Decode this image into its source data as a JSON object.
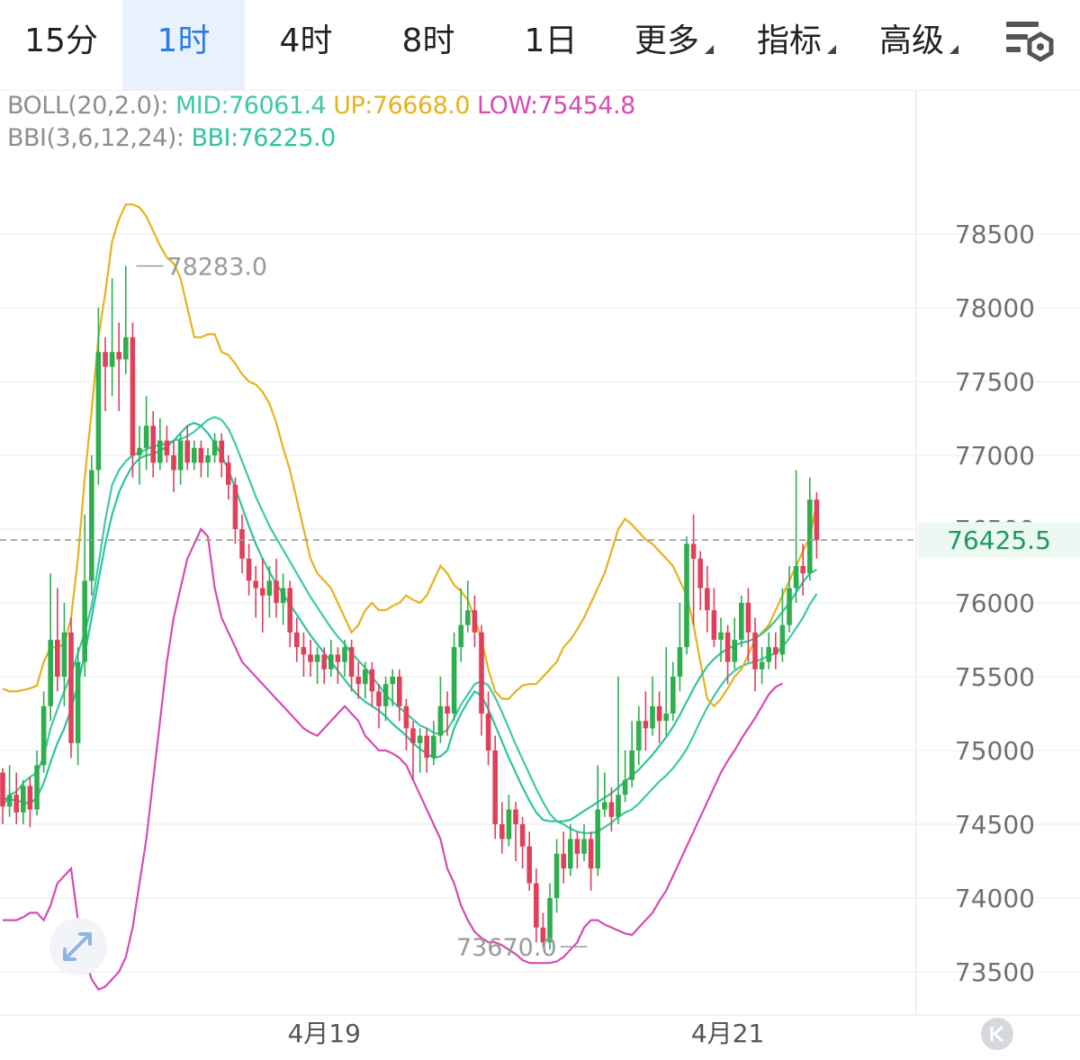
{
  "toolbar": {
    "tabs": [
      {
        "label": "15分",
        "active": false,
        "dropdown": false
      },
      {
        "label": "1时",
        "active": true,
        "dropdown": false
      },
      {
        "label": "4时",
        "active": false,
        "dropdown": false
      },
      {
        "label": "8时",
        "active": false,
        "dropdown": false
      },
      {
        "label": "1日",
        "active": false,
        "dropdown": false
      },
      {
        "label": "更多",
        "active": false,
        "dropdown": true
      },
      {
        "label": "指标",
        "active": false,
        "dropdown": true
      },
      {
        "label": "高级",
        "active": false,
        "dropdown": true
      }
    ],
    "settings_icon": "chart-settings-icon"
  },
  "legend": {
    "boll_name": "BOLL(20,2.0):",
    "boll_mid": "MID:76061.4",
    "boll_up": "UP:76668.0",
    "boll_low": "LOW:75454.8",
    "bbi_name": "BBI(3,6,12,24):",
    "bbi_value": "BBI:76225.0"
  },
  "colors": {
    "up": "#2fae4f",
    "down": "#e0405a",
    "boll_mid": "#3ec9a8",
    "boll_up": "#e6b21e",
    "boll_low": "#d64bb4",
    "bbi": "#2ec4a0",
    "active_tab": "#2d7be5",
    "grid": "#eef0f3"
  },
  "icons": {
    "expand": "expand-arrows-icon",
    "scroll_left": "scroll-to-start-icon"
  },
  "chart_data": {
    "type": "candlestick",
    "interval": "1时",
    "ylim": [
      73350,
      78900
    ],
    "y_ticks": [
      73500,
      74000,
      74500,
      75000,
      75500,
      76000,
      76500,
      77000,
      77500,
      78000,
      78500
    ],
    "y_tick_labels": [
      "73500",
      "74000",
      "74500",
      "75000",
      "75500",
      "76000",
      "76500",
      "77000",
      "77500",
      "78000",
      "78500"
    ],
    "x_labels": [
      {
        "label": "4月19",
        "index": 47
      },
      {
        "label": "4月21",
        "index": 106
      }
    ],
    "current_price": 76425.5,
    "current_price_label": "76425.5",
    "high_label": {
      "value": 78283.0,
      "text": "78283.0",
      "index": 19
    },
    "low_label": {
      "value": 73670.0,
      "text": "73670.0",
      "index": 86
    },
    "candles": [
      [
        74850,
        74620,
        74880,
        74500
      ],
      [
        74620,
        74700,
        74900,
        74550
      ],
      [
        74700,
        74580,
        74850,
        74500
      ],
      [
        74580,
        74760,
        74800,
        74500
      ],
      [
        74760,
        74600,
        74820,
        74480
      ],
      [
        74600,
        74900,
        75000,
        74560
      ],
      [
        74900,
        75300,
        75400,
        74850
      ],
      [
        75300,
        75750,
        76200,
        75200
      ],
      [
        75750,
        75500,
        76100,
        75400
      ],
      [
        75500,
        75800,
        76000,
        75300
      ],
      [
        75800,
        75050,
        75900,
        74950
      ],
      [
        75050,
        75600,
        75700,
        74900
      ],
      [
        75600,
        76150,
        76600,
        75500
      ],
      [
        76150,
        76900,
        77000,
        76050
      ],
      [
        76900,
        77700,
        78000,
        76800
      ],
      [
        77700,
        77600,
        77800,
        77300
      ],
      [
        77600,
        77700,
        78200,
        77400
      ],
      [
        77700,
        77650,
        77900,
        77300
      ],
      [
        77650,
        77800,
        78283,
        77550
      ],
      [
        77800,
        77000,
        77900,
        76850
      ],
      [
        77000,
        77050,
        77200,
        76800
      ],
      [
        77050,
        77200,
        77400,
        76900
      ],
      [
        77200,
        76950,
        77300,
        76850
      ],
      [
        76950,
        77100,
        77250,
        76900
      ],
      [
        77100,
        77000,
        77200,
        76950
      ],
      [
        77000,
        76900,
        77100,
        76750
      ],
      [
        76900,
        77100,
        77150,
        76800
      ],
      [
        77100,
        76950,
        77200,
        76900
      ],
      [
        76950,
        77050,
        77100,
        76900
      ],
      [
        77050,
        76950,
        77100,
        76850
      ],
      [
        76950,
        77000,
        77050,
        76850
      ],
      [
        77000,
        77100,
        77150,
        76950
      ],
      [
        77100,
        76950,
        77150,
        76850
      ],
      [
        76950,
        76800,
        77000,
        76700
      ],
      [
        76800,
        76500,
        76850,
        76400
      ],
      [
        76500,
        76300,
        76600,
        76200
      ],
      [
        76300,
        76150,
        76400,
        76050
      ],
      [
        76150,
        76100,
        76250,
        75900
      ],
      [
        76100,
        76050,
        76300,
        75800
      ],
      [
        76050,
        76150,
        76250,
        75900
      ],
      [
        76150,
        76000,
        76300,
        75900
      ],
      [
        76000,
        76100,
        76200,
        75850
      ],
      [
        76100,
        75800,
        76150,
        75700
      ],
      [
        75800,
        75700,
        75900,
        75600
      ],
      [
        75700,
        75650,
        75800,
        75500
      ],
      [
        75650,
        75600,
        75750,
        75500
      ],
      [
        75600,
        75650,
        75700,
        75450
      ],
      [
        75650,
        75550,
        75700,
        75450
      ],
      [
        75550,
        75650,
        75750,
        75500
      ],
      [
        75650,
        75600,
        75700,
        75450
      ],
      [
        75600,
        75700,
        75750,
        75500
      ],
      [
        75700,
        75500,
        75750,
        75400
      ],
      [
        75500,
        75450,
        75600,
        75350
      ],
      [
        75450,
        75550,
        75600,
        75350
      ],
      [
        75550,
        75400,
        75600,
        75300
      ],
      [
        75400,
        75300,
        75450,
        75150
      ],
      [
        75300,
        75450,
        75500,
        75200
      ],
      [
        75450,
        75500,
        75550,
        75300
      ],
      [
        75500,
        75300,
        75550,
        75200
      ],
      [
        75300,
        75150,
        75350,
        75000
      ],
      [
        75150,
        75050,
        75200,
        74800
      ],
      [
        75050,
        75100,
        75150,
        74850
      ],
      [
        75100,
        74950,
        75150,
        74850
      ],
      [
        74950,
        75100,
        75200,
        74900
      ],
      [
        75100,
        75300,
        75500,
        75050
      ],
      [
        75300,
        75250,
        75400,
        75100
      ],
      [
        75250,
        75700,
        75800,
        75200
      ],
      [
        75700,
        75850,
        76100,
        75600
      ],
      [
        75850,
        75950,
        76150,
        75800
      ],
      [
        75950,
        75800,
        76050,
        75700
      ],
      [
        75800,
        75250,
        75850,
        75100
      ],
      [
        75250,
        75000,
        75400,
        74900
      ],
      [
        75000,
        74500,
        75100,
        74400
      ],
      [
        74500,
        74400,
        74650,
        74300
      ],
      [
        74400,
        74600,
        74700,
        74350
      ],
      [
        74600,
        74500,
        74650,
        74250
      ],
      [
        74500,
        74350,
        74550,
        74200
      ],
      [
        74350,
        74100,
        74450,
        74050
      ],
      [
        74100,
        73800,
        74200,
        73700
      ],
      [
        73800,
        73700,
        73900,
        73670
      ],
      [
        73700,
        74000,
        74100,
        73650
      ],
      [
        74000,
        74300,
        74400,
        73900
      ],
      [
        74300,
        74200,
        74450,
        74100
      ],
      [
        74200,
        74400,
        74500,
        74150
      ],
      [
        74400,
        74300,
        74450,
        74200
      ],
      [
        74300,
        74400,
        74500,
        74250
      ],
      [
        74400,
        74200,
        74450,
        74050
      ],
      [
        74200,
        74600,
        74900,
        74150
      ],
      [
        74600,
        74650,
        74850,
        74550
      ],
      [
        74650,
        74550,
        74750,
        74450
      ],
      [
        74550,
        74700,
        75500,
        74500
      ],
      [
        74700,
        74800,
        75000,
        74650
      ],
      [
        74800,
        75000,
        75200,
        74750
      ],
      [
        75000,
        75200,
        75300,
        74900
      ],
      [
        75200,
        75150,
        75400,
        75000
      ],
      [
        75150,
        75300,
        75500,
        75100
      ],
      [
        75300,
        75200,
        75400,
        75050
      ],
      [
        75200,
        75250,
        75700,
        75100
      ],
      [
        75250,
        75500,
        75600,
        75200
      ],
      [
        75500,
        75700,
        76000,
        75400
      ],
      [
        75700,
        76400,
        76450,
        75650
      ],
      [
        76400,
        76300,
        76600,
        75850
      ],
      [
        76300,
        76100,
        76350,
        75950
      ],
      [
        76100,
        75950,
        76250,
        75800
      ],
      [
        75950,
        75750,
        76100,
        75700
      ],
      [
        75750,
        75800,
        75900,
        75600
      ],
      [
        75800,
        75600,
        75850,
        75450
      ],
      [
        75600,
        75750,
        75900,
        75550
      ],
      [
        75750,
        76000,
        76050,
        75700
      ],
      [
        76000,
        75800,
        76100,
        75600
      ],
      [
        75800,
        75550,
        75900,
        75400
      ],
      [
        75550,
        75600,
        75700,
        75450
      ],
      [
        75600,
        75700,
        75800,
        75550
      ],
      [
        75700,
        75650,
        75800,
        75550
      ],
      [
        75650,
        75850,
        76100,
        75600
      ],
      [
        75850,
        76100,
        76250,
        75800
      ],
      [
        76100,
        76250,
        76900,
        76000
      ],
      [
        76250,
        76200,
        76400,
        76050
      ],
      [
        76200,
        76700,
        76850,
        76150
      ],
      [
        76700,
        76425,
        76750,
        76300
      ]
    ],
    "series": [
      {
        "name": "MID",
        "color": "#3ec9a8",
        "values": [
          74620,
          74700,
          74720,
          74780,
          74820,
          74850,
          74960,
          75150,
          75280,
          75400,
          75520,
          75660,
          75800,
          75980,
          76260,
          76560,
          76800,
          76900,
          76960,
          77000,
          77020,
          77040,
          77060,
          77070,
          77080,
          77100,
          77110,
          77130,
          77160,
          77200,
          77240,
          77260,
          77240,
          77180,
          77080,
          76960,
          76840,
          76720,
          76620,
          76520,
          76440,
          76360,
          76280,
          76200,
          76120,
          76040,
          75970,
          75900,
          75830,
          75770,
          75720,
          75660,
          75610,
          75560,
          75500,
          75440,
          75380,
          75330,
          75290,
          75250,
          75210,
          75170,
          75150,
          75120,
          75110,
          75140,
          75220,
          75310,
          75380,
          75450,
          75470,
          75440,
          75360,
          75260,
          75150,
          75040,
          74940,
          74840,
          74740,
          74650,
          74570,
          74520,
          74500,
          74470,
          74450,
          74440,
          74440,
          74450,
          74480,
          74510,
          74550,
          74580,
          74600,
          74640,
          74690,
          74740,
          74790,
          74830,
          74880,
          74940,
          75010,
          75100,
          75200,
          75290,
          75370,
          75440,
          75500,
          75540,
          75570,
          75590,
          75600,
          75620,
          75640,
          75660,
          75700,
          75760,
          75830,
          75900,
          75990,
          76061
        ]
      },
      {
        "name": "UP",
        "color": "#e6b21e",
        "values": [
          75420,
          75400,
          75400,
          75410,
          75420,
          75440,
          75600,
          75700,
          75700,
          75720,
          75900,
          76300,
          76850,
          77300,
          77800,
          78100,
          78450,
          78600,
          78700,
          78700,
          78680,
          78620,
          78520,
          78420,
          78340,
          78300,
          78200,
          78000,
          77800,
          77800,
          77820,
          77820,
          77700,
          77680,
          77620,
          77550,
          77500,
          77480,
          77430,
          77350,
          77220,
          77050,
          76900,
          76700,
          76500,
          76300,
          76200,
          76150,
          76100,
          76000,
          75900,
          75800,
          75850,
          75950,
          76000,
          75950,
          75950,
          75980,
          76000,
          76050,
          76020,
          76000,
          76050,
          76150,
          76250,
          76200,
          76120,
          76080,
          76020,
          75900,
          75750,
          75550,
          75400,
          75350,
          75350,
          75400,
          75440,
          75450,
          75450,
          75500,
          75550,
          75600,
          75700,
          75750,
          75820,
          75900,
          76000,
          76100,
          76200,
          76350,
          76500,
          76570,
          76530,
          76480,
          76430,
          76400,
          76350,
          76300,
          76250,
          76150,
          76050,
          75850,
          75600,
          75350,
          75300,
          75350,
          75420,
          75500,
          75550,
          75650,
          75750,
          75800,
          75850,
          75950,
          76050,
          76150,
          76250,
          76350,
          76450,
          76668
        ]
      },
      {
        "name": "LOW",
        "color": "#d64bb4",
        "values": [
          73850,
          73850,
          73850,
          73870,
          73900,
          73900,
          73850,
          73950,
          74100,
          74150,
          74200,
          73850,
          73600,
          73450,
          73380,
          73400,
          73450,
          73500,
          73600,
          73800,
          74100,
          74400,
          74800,
          75200,
          75600,
          75900,
          76100,
          76300,
          76400,
          76500,
          76450,
          76100,
          75900,
          75800,
          75700,
          75600,
          75550,
          75500,
          75450,
          75400,
          75350,
          75300,
          75250,
          75200,
          75150,
          75120,
          75100,
          75150,
          75200,
          75250,
          75300,
          75250,
          75200,
          75100,
          75050,
          75000,
          75000,
          74980,
          74950,
          74900,
          74800,
          74700,
          74600,
          74500,
          74400,
          74200,
          74100,
          73950,
          73850,
          73770,
          73730,
          73700,
          73700,
          73680,
          73650,
          73620,
          73580,
          73560,
          73560,
          73560,
          73560,
          73570,
          73600,
          73650,
          73700,
          73800,
          73850,
          73850,
          73820,
          73800,
          73780,
          73760,
          73750,
          73800,
          73850,
          73900,
          73980,
          74050,
          74150,
          74250,
          74350,
          74450,
          74550,
          74650,
          74750,
          74850,
          74930,
          75000,
          75080,
          75150,
          75220,
          75300,
          75380,
          75430,
          75454
        ]
      },
      {
        "name": "BBI",
        "color": "#2ec4a0",
        "values": [
          74680,
          74670,
          74660,
          74650,
          74640,
          74680,
          74780,
          74920,
          75050,
          75150,
          75280,
          75450,
          75650,
          75900,
          76150,
          76400,
          76600,
          76750,
          76850,
          76930,
          76980,
          77000,
          77010,
          77030,
          77060,
          77100,
          77150,
          77200,
          77220,
          77200,
          77150,
          77080,
          77000,
          76900,
          76780,
          76650,
          76520,
          76400,
          76300,
          76210,
          76130,
          76060,
          75990,
          75920,
          75850,
          75780,
          75720,
          75660,
          75600,
          75540,
          75480,
          75420,
          75370,
          75330,
          75300,
          75270,
          75230,
          75180,
          75140,
          75100,
          75050,
          75010,
          74980,
          74950,
          74960,
          75000,
          75150,
          75250,
          75330,
          75400,
          75370,
          75280,
          75170,
          75060,
          74950,
          74850,
          74750,
          74660,
          74580,
          74530,
          74520,
          74520,
          74520,
          74530,
          74560,
          74590,
          74620,
          74650,
          74680,
          74710,
          74750,
          74790,
          74830,
          74870,
          74920,
          74970,
          75030,
          75090,
          75160,
          75240,
          75330,
          75420,
          75500,
          75570,
          75620,
          75660,
          75690,
          75710,
          75730,
          75740,
          75760,
          75790,
          75830,
          75880,
          75940,
          76000,
          76070,
          76140,
          76200,
          76225
        ]
      }
    ]
  }
}
